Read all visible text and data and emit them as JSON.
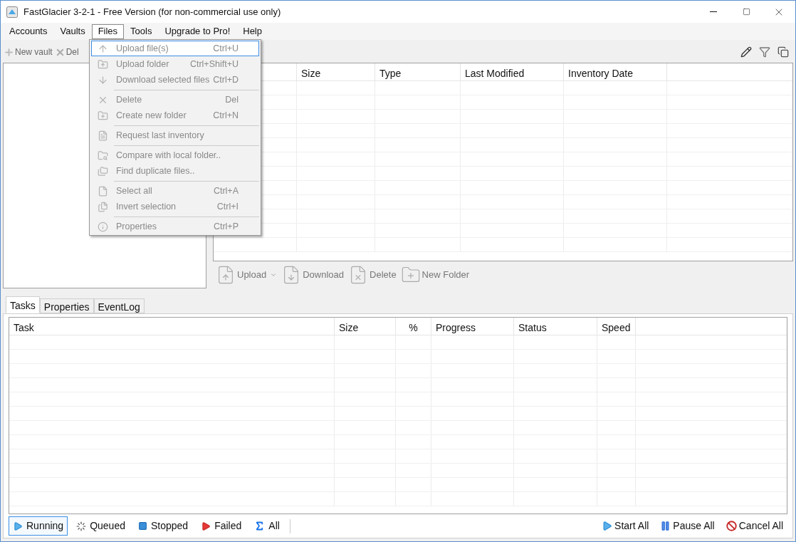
{
  "window": {
    "title": "FastGlacier 3-2-1 - Free Version (for non-commercial use only)"
  },
  "menu_bar": [
    {
      "label": "Accounts",
      "selected": false
    },
    {
      "label": "Vaults",
      "selected": false
    },
    {
      "label": "Files",
      "selected": true
    },
    {
      "label": "Tools",
      "selected": false
    },
    {
      "label": "Upgrade to Pro!",
      "selected": false
    },
    {
      "label": "Help",
      "selected": false
    }
  ],
  "vault_toolbar": [
    {
      "label": "New vault"
    },
    {
      "label": "Del"
    }
  ],
  "files_menu": [
    {
      "kind": "item",
      "label": "Upload file(s)",
      "shortcut": "Ctrl+U",
      "disabled": true,
      "selected": true
    },
    {
      "kind": "item",
      "label": "Upload folder",
      "shortcut": "Ctrl+Shift+U",
      "disabled": true,
      "selected": false
    },
    {
      "kind": "item",
      "label": "Download selected files",
      "shortcut": "Ctrl+D",
      "disabled": true,
      "selected": false
    },
    {
      "kind": "separator"
    },
    {
      "kind": "item",
      "label": "Delete",
      "shortcut": "Del",
      "disabled": true,
      "selected": false
    },
    {
      "kind": "item",
      "label": "Create new folder",
      "shortcut": "Ctrl+N",
      "disabled": true,
      "selected": false
    },
    {
      "kind": "separator"
    },
    {
      "kind": "item",
      "label": "Request last inventory",
      "disabled": true,
      "selected": false
    },
    {
      "kind": "separator"
    },
    {
      "kind": "item",
      "label": "Compare with local folder..",
      "disabled": true,
      "selected": false
    },
    {
      "kind": "item",
      "label": "Find duplicate files..",
      "disabled": true,
      "selected": false
    },
    {
      "kind": "separator"
    },
    {
      "kind": "item",
      "label": "Select all",
      "shortcut": "Ctrl+A",
      "disabled": true,
      "selected": false
    },
    {
      "kind": "item",
      "label": "Invert selection",
      "shortcut": "Ctrl+I",
      "disabled": true,
      "selected": false
    },
    {
      "kind": "separator"
    },
    {
      "kind": "item",
      "label": "Properties",
      "shortcut": "Ctrl+P",
      "disabled": true,
      "selected": false
    }
  ],
  "file_table": {
    "columns": [
      "Size",
      "Type",
      "Last Modified",
      "Inventory Date"
    ]
  },
  "file_actions": [
    {
      "label": "Upload",
      "dropdown": true
    },
    {
      "label": "Download",
      "dropdown": false
    },
    {
      "label": "Delete",
      "dropdown": false
    },
    {
      "label": "New Folder",
      "dropdown": false
    }
  ],
  "bottom_tabs": [
    {
      "label": "Tasks",
      "selected": true
    },
    {
      "label": "Properties",
      "selected": false
    },
    {
      "label": "EventLog",
      "selected": false
    }
  ],
  "task_table": {
    "columns": [
      "Task",
      "Size",
      "%",
      "Progress",
      "Status",
      "Speed"
    ]
  },
  "filters": [
    {
      "label": "Running",
      "selected": true
    },
    {
      "label": "Queued",
      "selected": false
    },
    {
      "label": "Stopped",
      "selected": false
    },
    {
      "label": "Failed",
      "selected": false
    },
    {
      "label": "All",
      "selected": false
    }
  ],
  "task_actions": [
    {
      "label": "Start All"
    },
    {
      "label": "Pause All"
    },
    {
      "label": "Cancel All"
    }
  ]
}
